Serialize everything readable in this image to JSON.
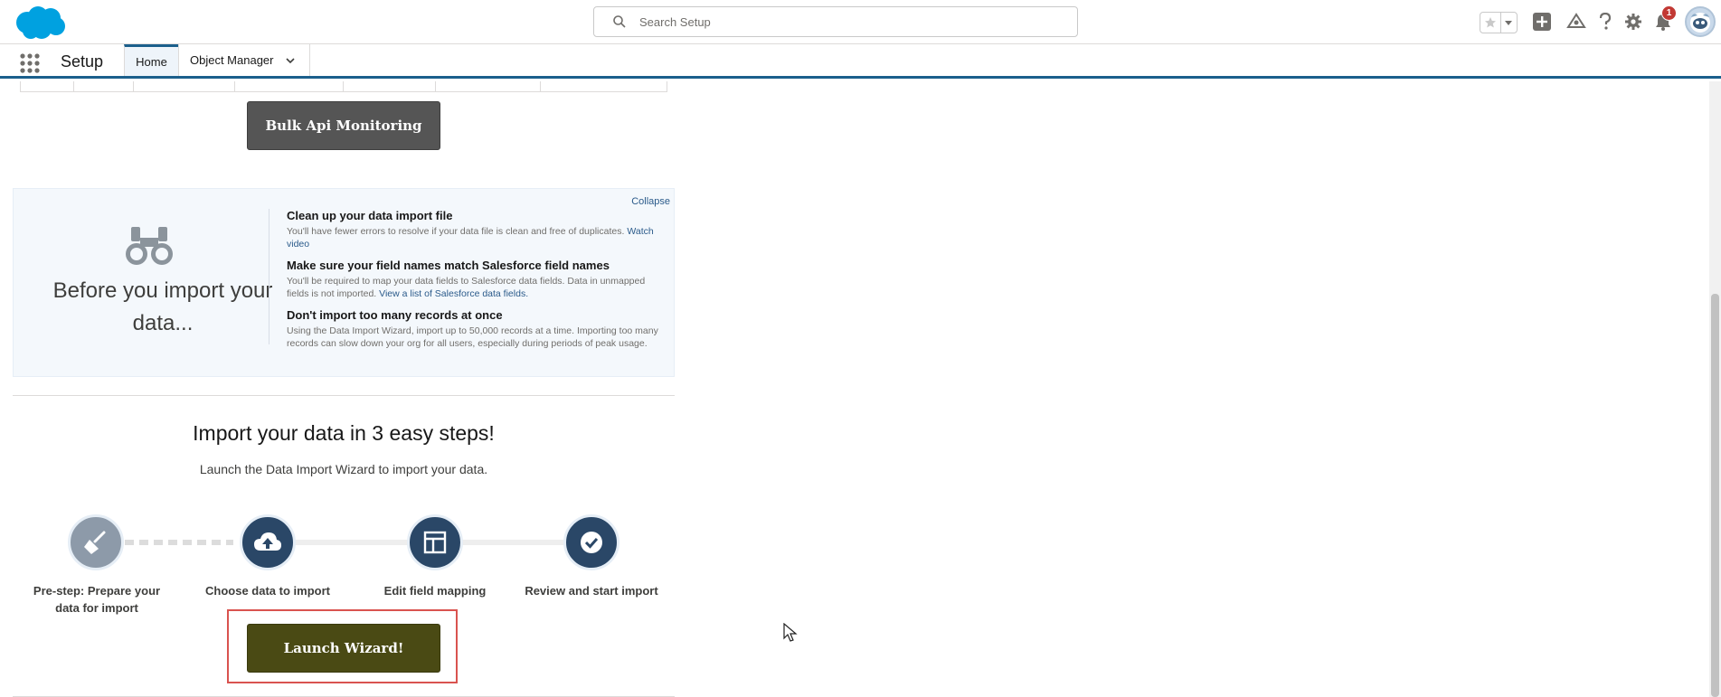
{
  "header": {
    "search_placeholder": "Search Setup",
    "notification_count": "1"
  },
  "context_bar": {
    "app_name": "Setup",
    "tabs": [
      {
        "label": "Home"
      },
      {
        "label": "Object Manager"
      }
    ]
  },
  "content": {
    "bulk_api_button": "Bulk Api Monitoring",
    "tips": {
      "collapse_label": "Collapse",
      "heading": "Before you import your data...",
      "items": [
        {
          "title": "Clean up your data import file",
          "text": "You'll have fewer errors to resolve if your data file is clean and free of duplicates.",
          "link": "Watch video"
        },
        {
          "title": "Make sure your field names match Salesforce field names",
          "text": "You'll be required to map your data fields to Salesforce data fields. Data in unmapped fields is not imported.",
          "link": "View a list of Salesforce data fields."
        },
        {
          "title": "Don't import too many records at once",
          "text": "Using the Data Import Wizard, import up to 50,000 records at a time. Importing too many records can slow down your org for all users, especially during periods of peak usage."
        }
      ]
    },
    "steps_title": "Import your data in 3 easy steps!",
    "steps_subtitle": "Launch the Data Import Wizard to import your data.",
    "steps": [
      {
        "label": "Pre-step: Prepare your data for import",
        "icon": "broom-icon"
      },
      {
        "label": "Choose data to import",
        "icon": "cloud-upload-icon"
      },
      {
        "label": "Edit field mapping",
        "icon": "layout-icon"
      },
      {
        "label": "Review and start import",
        "icon": "check-icon"
      }
    ],
    "launch_button": "Launch Wizard!"
  },
  "colors": {
    "brand_blue": "#1b5f8c",
    "step_active": "#2a4767",
    "launch_button": "#4a4a14",
    "highlight_red": "#d9534f"
  }
}
